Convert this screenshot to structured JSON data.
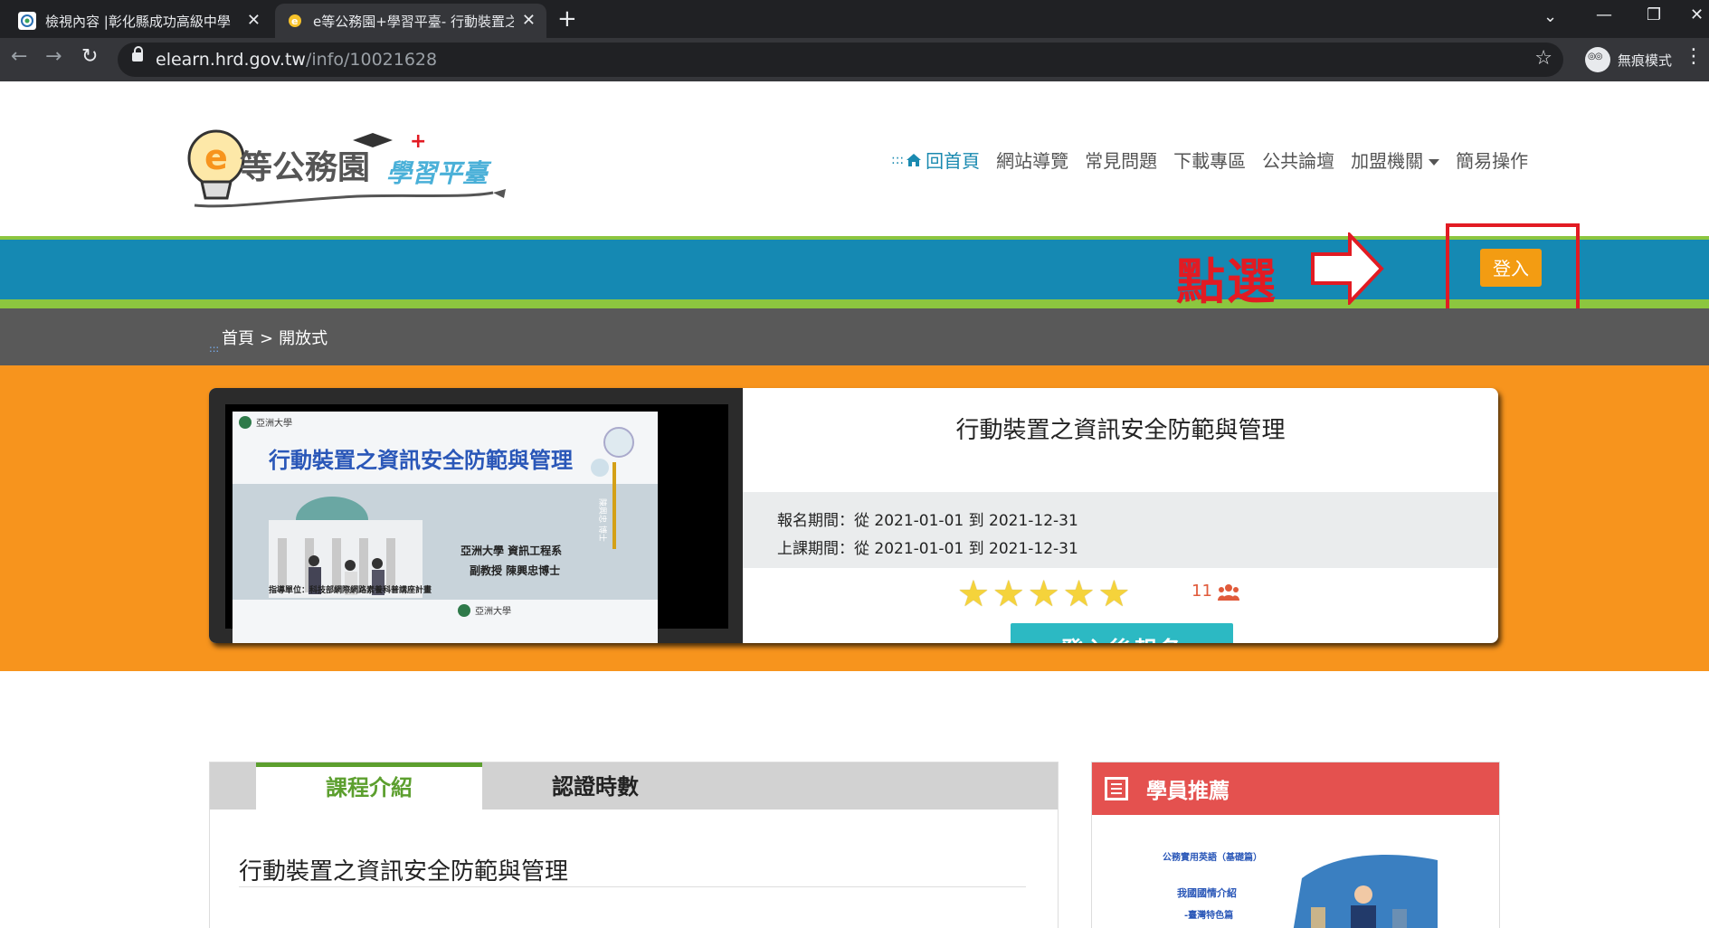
{
  "browser": {
    "tabs": [
      {
        "title": "檢視內容 |彰化縣成功高級中學",
        "active": false
      },
      {
        "title": "e等公務園+學習平臺- 行動裝置之",
        "active": true
      }
    ],
    "url_host": "elearn.hrd.gov.tw",
    "url_path": "/info/10021628",
    "profile_label": "無痕模式"
  },
  "site": {
    "logo_main": "等公務園",
    "logo_sub": "學習平臺",
    "nav": {
      "prefix": ":::",
      "home": "回首頁",
      "items": [
        "網站導覽",
        "常見問題",
        "下載專區",
        "公共論壇"
      ],
      "dropdown": "加盟機關",
      "last": "簡易操作"
    },
    "annotation": "點選",
    "login_label": "登入",
    "breadcrumb": {
      "home": "首頁",
      "sep": ">",
      "current": "開放式"
    },
    "course": {
      "title": "行動裝置之資訊安全防範與管理",
      "signup_period": "報名期間：從 2021-01-01 到 2021-12-31",
      "class_period": "上課期間：從 2021-01-01 到 2021-12-31",
      "rating_stars": 5,
      "learner_count": "11",
      "enroll_button": "登入後報名",
      "slide": {
        "university": "亞洲大學",
        "heading": "行動裝置之資訊安全防範與管理",
        "dept": "亞洲大學 資訊工程系",
        "speaker": "副教授 陳興忠博士",
        "sponsor": "指導單位：科技部網際網路素養科普講座計畫",
        "side_text": "陳興忠 博士"
      }
    },
    "tabs": [
      {
        "label": "課程介紹",
        "active": true
      },
      {
        "label": "認證時數",
        "active": false
      }
    ],
    "course_heading": "行動裝置之資訊安全防範與管理",
    "recommend_title": "學員推薦",
    "recommend_thumb": {
      "line1": "公務實用英語（基礎篇）",
      "line2": "我國國情介紹",
      "line3": "-臺灣特色篇"
    }
  },
  "colors": {
    "accent_blue": "#1589b3",
    "green": "#8cc63f",
    "orange": "#f7941d",
    "login_orange": "#f39c12",
    "annotation_red": "#e21b23",
    "enroll_teal": "#2cb9c3"
  }
}
